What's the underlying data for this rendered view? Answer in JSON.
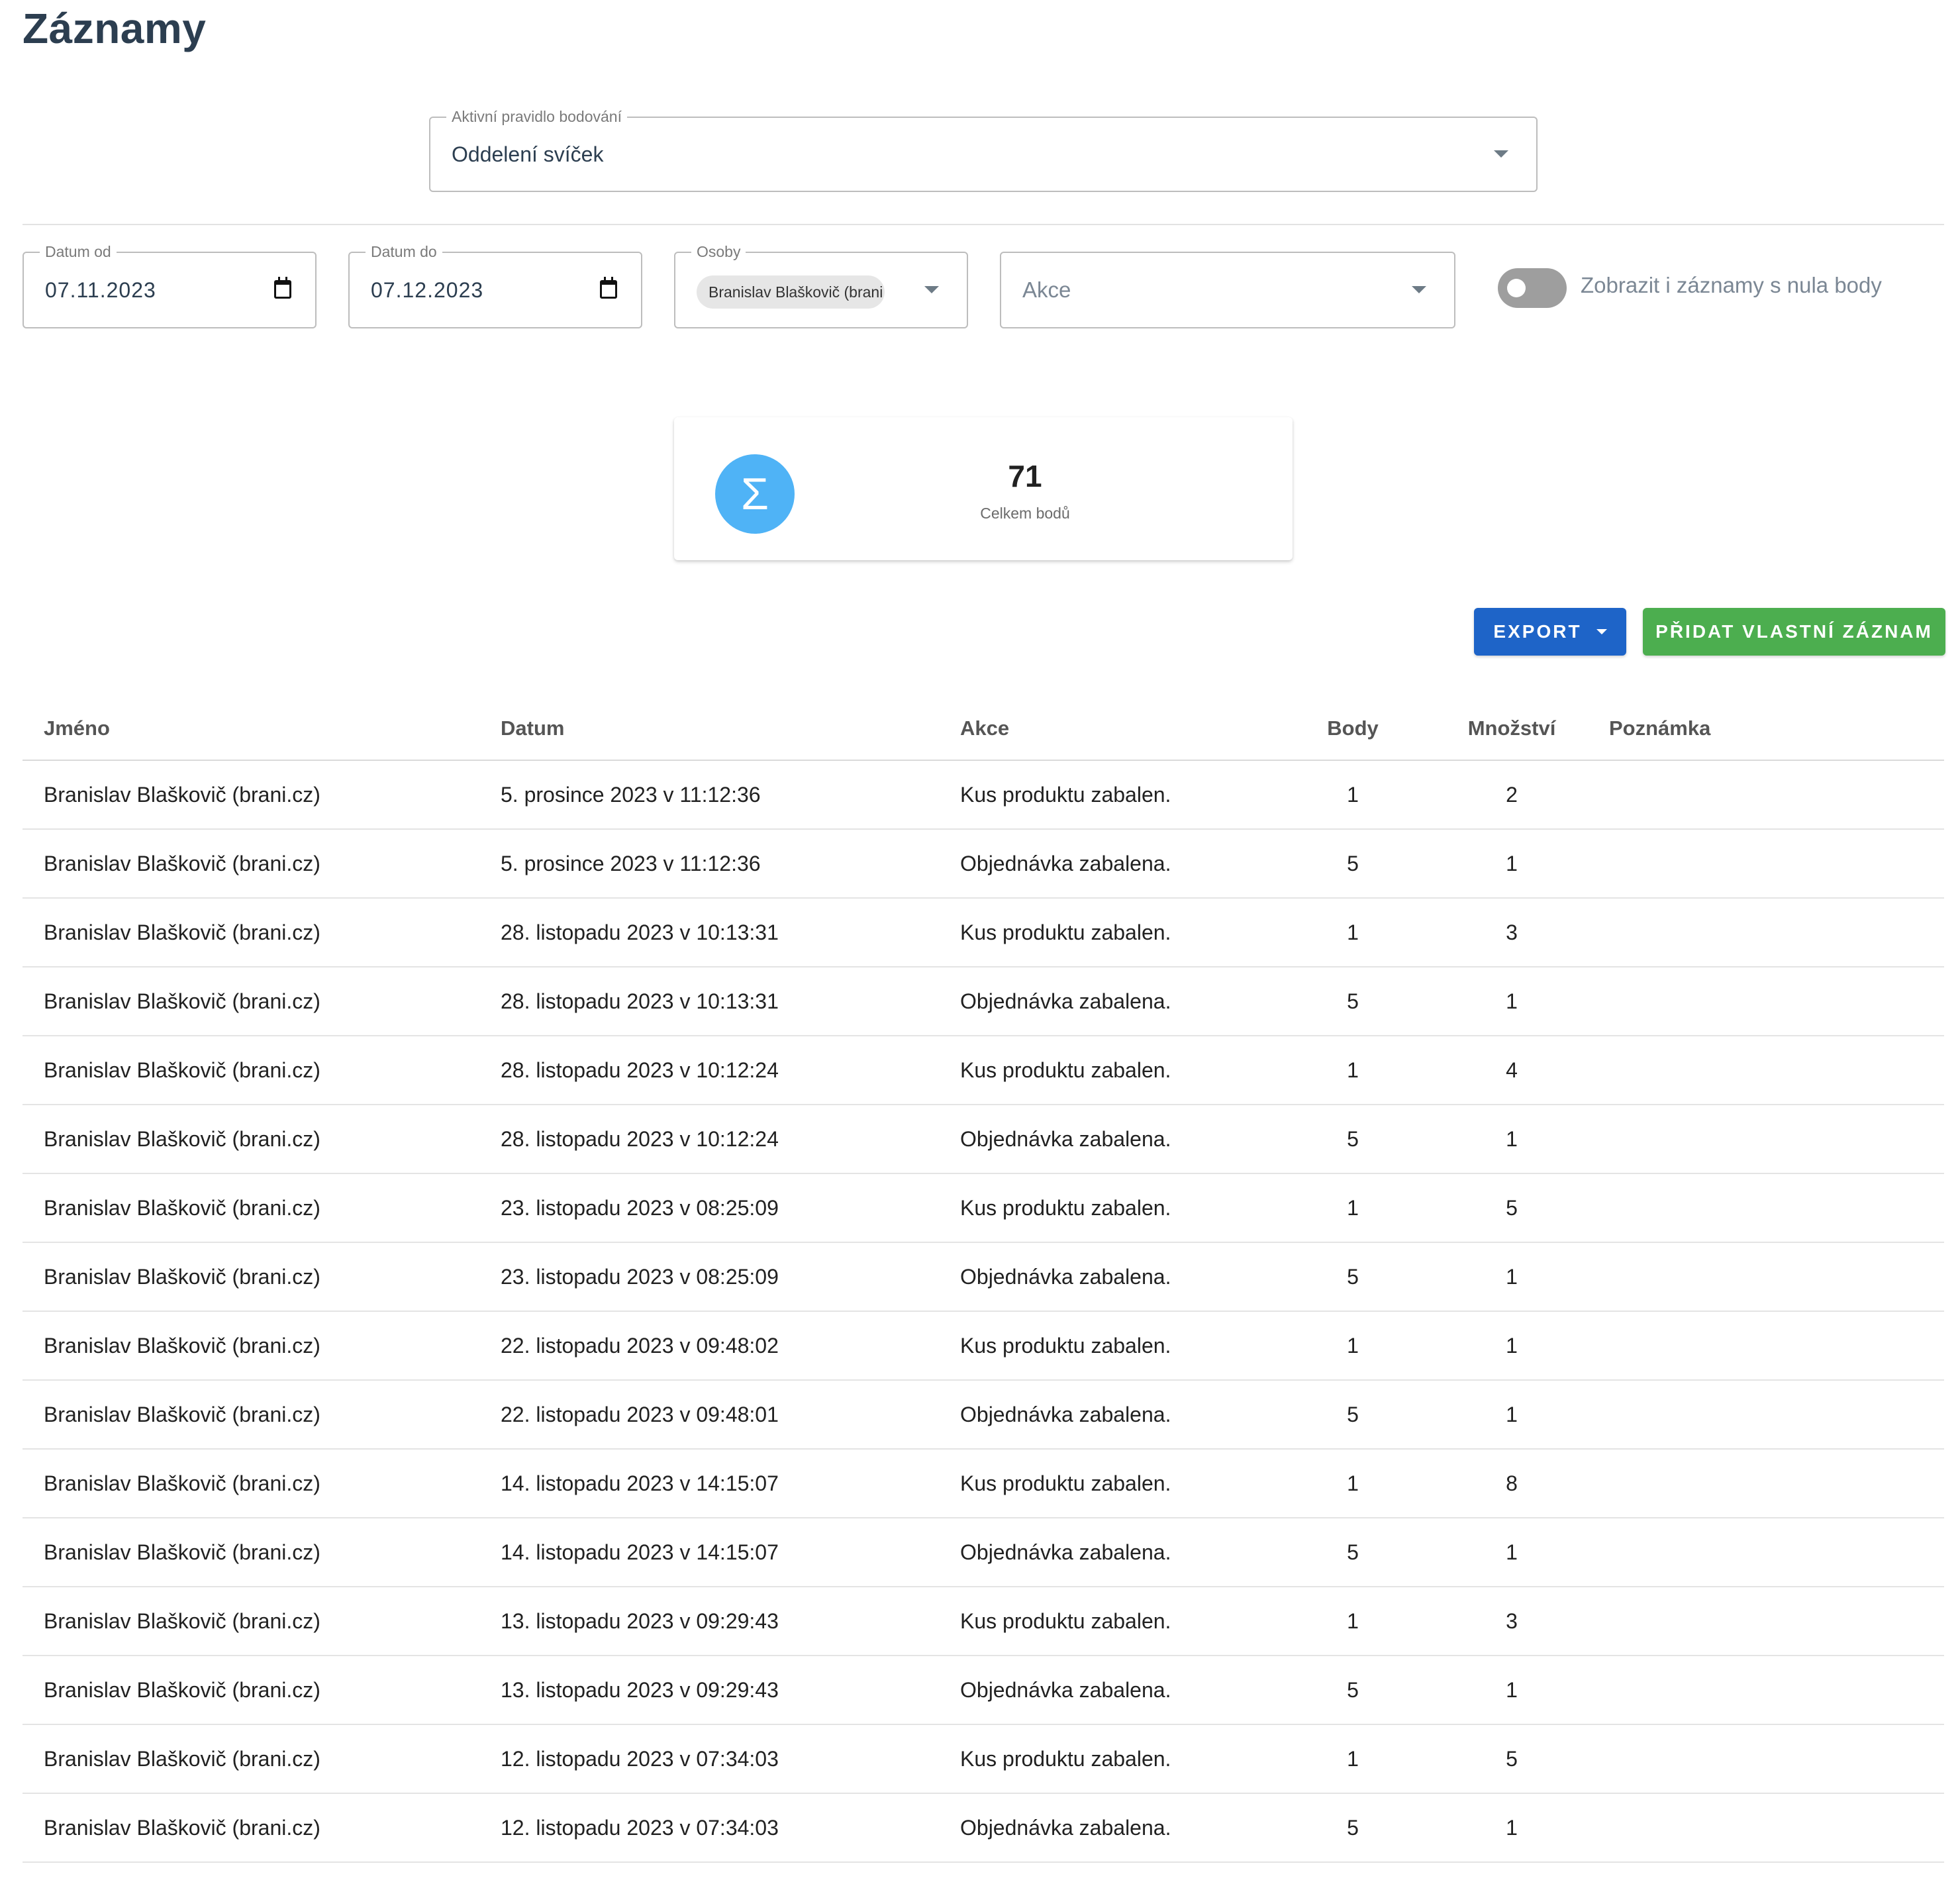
{
  "page": {
    "title": "Záznamy"
  },
  "rule_select": {
    "label": "Aktivní pravidlo bodování",
    "value": "Oddelení svíček"
  },
  "filters": {
    "date_from": {
      "label": "Datum od",
      "value": "07.11.2023"
    },
    "date_to": {
      "label": "Datum do",
      "value": "07.12.2023"
    },
    "persons": {
      "label": "Osoby",
      "chips": [
        "Branislav Blaškovič (brani.cz)"
      ]
    },
    "actions": {
      "placeholder": "Akce"
    },
    "zero_toggle": {
      "label": "Zobrazit i záznamy s nula body",
      "checked": false
    }
  },
  "stats": {
    "icon": "sigma-icon",
    "symbol": "Σ",
    "value": "71",
    "label": "Celkem bodů",
    "accent": "#4fb3f6"
  },
  "buttons": {
    "export": {
      "label": "EXPORT",
      "color": "#1e64c8"
    },
    "add": {
      "label": "PŘIDAT VLASTNÍ ZÁZNAM",
      "color": "#4cae4f"
    }
  },
  "table": {
    "columns": [
      "Jméno",
      "Datum",
      "Akce",
      "Body",
      "Množství",
      "Poznámka"
    ],
    "rows": [
      {
        "name": "Branislav Blaškovič (brani.cz)",
        "date": "5. prosince 2023 v 11:12:36",
        "action": "Kus produktu zabalen.",
        "points": "1",
        "qty": "2",
        "note": ""
      },
      {
        "name": "Branislav Blaškovič (brani.cz)",
        "date": "5. prosince 2023 v 11:12:36",
        "action": "Objednávka zabalena.",
        "points": "5",
        "qty": "1",
        "note": ""
      },
      {
        "name": "Branislav Blaškovič (brani.cz)",
        "date": "28. listopadu 2023 v 10:13:31",
        "action": "Kus produktu zabalen.",
        "points": "1",
        "qty": "3",
        "note": ""
      },
      {
        "name": "Branislav Blaškovič (brani.cz)",
        "date": "28. listopadu 2023 v 10:13:31",
        "action": "Objednávka zabalena.",
        "points": "5",
        "qty": "1",
        "note": ""
      },
      {
        "name": "Branislav Blaškovič (brani.cz)",
        "date": "28. listopadu 2023 v 10:12:24",
        "action": "Kus produktu zabalen.",
        "points": "1",
        "qty": "4",
        "note": ""
      },
      {
        "name": "Branislav Blaškovič (brani.cz)",
        "date": "28. listopadu 2023 v 10:12:24",
        "action": "Objednávka zabalena.",
        "points": "5",
        "qty": "1",
        "note": ""
      },
      {
        "name": "Branislav Blaškovič (brani.cz)",
        "date": "23. listopadu 2023 v 08:25:09",
        "action": "Kus produktu zabalen.",
        "points": "1",
        "qty": "5",
        "note": ""
      },
      {
        "name": "Branislav Blaškovič (brani.cz)",
        "date": "23. listopadu 2023 v 08:25:09",
        "action": "Objednávka zabalena.",
        "points": "5",
        "qty": "1",
        "note": ""
      },
      {
        "name": "Branislav Blaškovič (brani.cz)",
        "date": "22. listopadu 2023 v 09:48:02",
        "action": "Kus produktu zabalen.",
        "points": "1",
        "qty": "1",
        "note": ""
      },
      {
        "name": "Branislav Blaškovič (brani.cz)",
        "date": "22. listopadu 2023 v 09:48:01",
        "action": "Objednávka zabalena.",
        "points": "5",
        "qty": "1",
        "note": ""
      },
      {
        "name": "Branislav Blaškovič (brani.cz)",
        "date": "14. listopadu 2023 v 14:15:07",
        "action": "Kus produktu zabalen.",
        "points": "1",
        "qty": "8",
        "note": ""
      },
      {
        "name": "Branislav Blaškovič (brani.cz)",
        "date": "14. listopadu 2023 v 14:15:07",
        "action": "Objednávka zabalena.",
        "points": "5",
        "qty": "1",
        "note": ""
      },
      {
        "name": "Branislav Blaškovič (brani.cz)",
        "date": "13. listopadu 2023 v 09:29:43",
        "action": "Kus produktu zabalen.",
        "points": "1",
        "qty": "3",
        "note": ""
      },
      {
        "name": "Branislav Blaškovič (brani.cz)",
        "date": "13. listopadu 2023 v 09:29:43",
        "action": "Objednávka zabalena.",
        "points": "5",
        "qty": "1",
        "note": ""
      },
      {
        "name": "Branislav Blaškovič (brani.cz)",
        "date": "12. listopadu 2023 v 07:34:03",
        "action": "Kus produktu zabalen.",
        "points": "1",
        "qty": "5",
        "note": ""
      },
      {
        "name": "Branislav Blaškovič (brani.cz)",
        "date": "12. listopadu 2023 v 07:34:03",
        "action": "Objednávka zabalena.",
        "points": "5",
        "qty": "1",
        "note": ""
      }
    ]
  }
}
